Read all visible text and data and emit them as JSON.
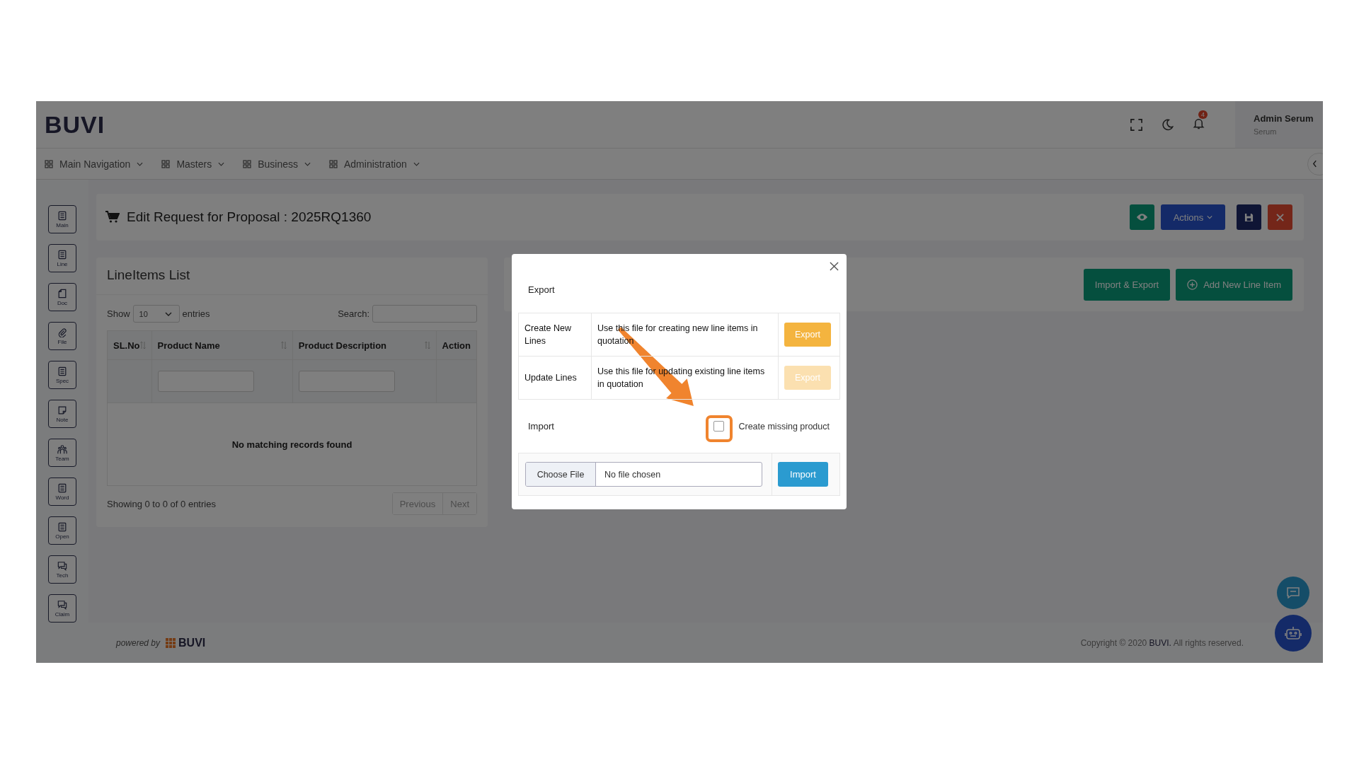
{
  "header": {
    "logo": "BUVI",
    "notification_count": "4",
    "user_name": "Admin Serum",
    "user_role": "Serum"
  },
  "nav": [
    {
      "label": "Main Navigation"
    },
    {
      "label": "Masters"
    },
    {
      "label": "Business"
    },
    {
      "label": "Administration"
    }
  ],
  "sidebar": [
    {
      "label": "Main",
      "kind": "list"
    },
    {
      "label": "Line",
      "kind": "list"
    },
    {
      "label": "Doc",
      "kind": "page"
    },
    {
      "label": "File",
      "kind": "clip"
    },
    {
      "label": "Spec",
      "kind": "list"
    },
    {
      "label": "Note",
      "kind": "note"
    },
    {
      "label": "Team",
      "kind": "team"
    },
    {
      "label": "Word",
      "kind": "list"
    },
    {
      "label": "Open",
      "kind": "list"
    },
    {
      "label": "Tech",
      "kind": "chat"
    },
    {
      "label": "Claim",
      "kind": "chat"
    }
  ],
  "page_title": "Edit Request for Proposal : 2025RQ1360",
  "toolbar": {
    "actions_label": "Actions"
  },
  "lineitems": {
    "title": "LineItems List",
    "show_label": "Show",
    "page_size": "10",
    "entries_label": "entries",
    "search_label": "Search:",
    "columns": [
      {
        "label": "SL.No",
        "sortable": true
      },
      {
        "label": "Product Name",
        "sortable": true
      },
      {
        "label": "Product Description",
        "sortable": true
      },
      {
        "label": "Action",
        "sortable": false
      }
    ],
    "empty_message": "No matching records found",
    "info": "Showing 0 to 0 of 0 entries",
    "pagination": [
      "Previous",
      "Next"
    ]
  },
  "panel_buttons": {
    "import_export": "Import & Export",
    "add": "Add New Line Item"
  },
  "modal": {
    "export_heading": "Export",
    "export_rows": [
      {
        "name": "Create New Lines",
        "description": "Use this file for creating new line items in quotation",
        "button": "Export",
        "disabled": false
      },
      {
        "name": "Update Lines",
        "description": "Use this file for updating existing line items in quotation",
        "button": "Export",
        "disabled": true
      }
    ],
    "import_heading": "Import",
    "create_missing": {
      "label": "Create missing product",
      "checked": false
    },
    "file_button": "Choose File",
    "file_status": "No file chosen",
    "import_button": "Import"
  },
  "footer": {
    "powered_by": "powered by",
    "brand": "BUVI",
    "copyright_prefix": "Copyright © 2020 ",
    "copyright_brand": "BUVI.",
    "copyright_suffix": " All rights reserved."
  }
}
